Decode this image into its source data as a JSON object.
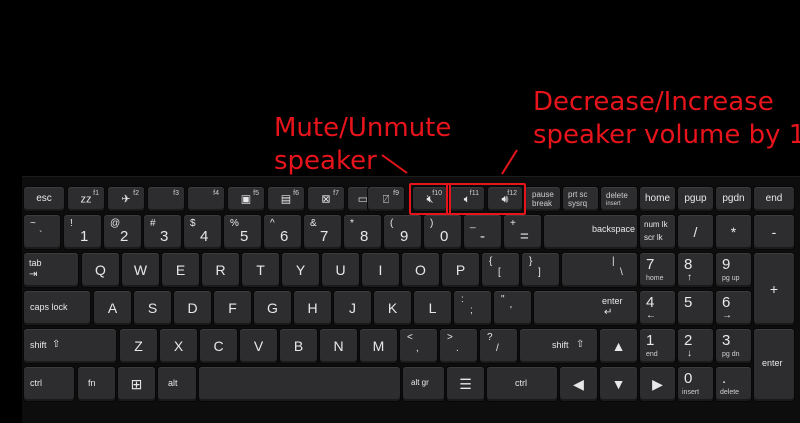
{
  "annotations": {
    "mute_line1": "Mute/Unmute",
    "mute_line2": "speaker",
    "volume_line1": "Decrease/Increase",
    "volume_line2": "speaker volume by 1"
  },
  "colors": {
    "annotation": "#e8141b",
    "key": "#2d2d2f",
    "background": "#000000"
  },
  "fn_row": {
    "esc": "esc",
    "f1": "f1",
    "f1_icon": "zz",
    "f2": "f2",
    "f3": "f3",
    "f4": "f4",
    "f5": "f5",
    "f6": "f6",
    "f7": "f7",
    "f8": "f8",
    "f9": "f9",
    "f10": "f10",
    "f11": "f11",
    "f12": "f12",
    "pause": "pause",
    "break": "break",
    "prtsc": "prt sc",
    "sysrq": "sysrq",
    "delete": "delete",
    "insert": "insert",
    "home": "home",
    "pgup": "pgup",
    "pgdn": "pgdn",
    "end": "end",
    "icons": [
      "sleep-icon",
      "airplane-icon",
      "display-icon",
      "brightness-down-icon",
      "brightness-up-icon",
      "display-off-icon",
      "projector-icon",
      "touchpad-icon",
      "mute-icon",
      "volume-down-icon",
      "volume-up-icon"
    ]
  },
  "number_row": {
    "tilde": "~",
    "backtick": "`",
    "n1": "1",
    "s1": "!",
    "n2": "2",
    "s2": "@",
    "n3": "3",
    "s3": "#",
    "n4": "4",
    "s4": "$",
    "n5": "5",
    "s5": "%",
    "n6": "6",
    "s6": "^",
    "n7": "7",
    "s7": "&",
    "n8": "8",
    "s8": "*",
    "n9": "9",
    "s9": "(",
    "n0": "0",
    "s0": ")",
    "minus": "-",
    "under": "_",
    "equals": "=",
    "plus": "+",
    "backspace": "backspace",
    "numlk": "num lk",
    "scrlk": "scr lk",
    "divide": "/",
    "multiply": "*",
    "subtract": "-"
  },
  "tab_row": {
    "tab": "tab",
    "q": "Q",
    "w": "W",
    "e": "E",
    "r": "R",
    "t": "T",
    "y": "Y",
    "u": "U",
    "i": "I",
    "o": "O",
    "p": "P",
    "lbracket": "[",
    "lbrace": "{",
    "rbracket": "]",
    "rbrace": "}",
    "backslash": "\\",
    "pipe": "|",
    "n7": "7",
    "home": "home",
    "n8": "8",
    "n9": "9",
    "pgup": "pg up",
    "plus": "+"
  },
  "caps_row": {
    "caps": "caps lock",
    "a": "A",
    "s": "S",
    "d": "D",
    "f": "F",
    "g": "G",
    "h": "H",
    "j": "J",
    "k": "K",
    "l": "L",
    "semicolon": ";",
    "colon": ":",
    "quote": "'",
    "dquote": "\"",
    "enter": "enter",
    "n4": "4",
    "n5": "5",
    "n6": "6"
  },
  "shift_row": {
    "shift": "shift",
    "z": "Z",
    "x": "X",
    "c": "C",
    "v": "V",
    "b": "B",
    "n": "N",
    "m": "M",
    "comma": ",",
    "lt": "<",
    "period": ".",
    "gt": ">",
    "slash": "/",
    "question": "?",
    "n1": "1",
    "end": "end",
    "n2": "2",
    "n3": "3",
    "pgdn": "pg dn"
  },
  "bottom_row": {
    "ctrl": "ctrl",
    "fn": "fn",
    "alt": "alt",
    "altgr": "alt gr",
    "ctrl2": "ctrl",
    "n0": "0",
    "insert": "insert",
    "period": ".",
    "delete": "delete",
    "enter": "enter"
  }
}
